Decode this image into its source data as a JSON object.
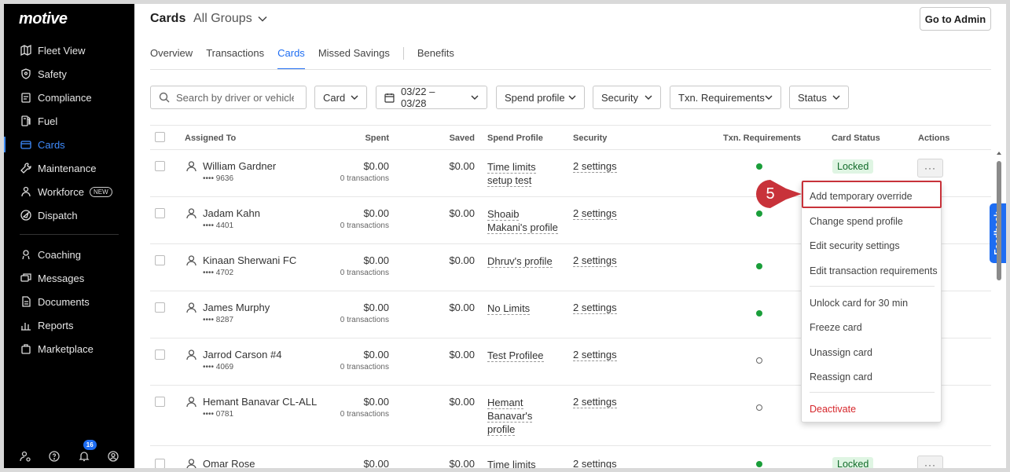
{
  "app": {
    "logo": "motive"
  },
  "sidebar": {
    "items": [
      {
        "label": "Fleet View",
        "icon": "map-icon"
      },
      {
        "label": "Safety",
        "icon": "shield-icon"
      },
      {
        "label": "Compliance",
        "icon": "clipboard-icon"
      },
      {
        "label": "Fuel",
        "icon": "fuel-pump-icon"
      },
      {
        "label": "Cards",
        "icon": "credit-card-icon",
        "active": true
      },
      {
        "label": "Maintenance",
        "icon": "wrench-icon"
      },
      {
        "label": "Workforce",
        "icon": "workforce-icon",
        "badge": "NEW"
      },
      {
        "label": "Dispatch",
        "icon": "dispatch-icon"
      },
      {
        "label": "Coaching",
        "icon": "coaching-icon"
      },
      {
        "label": "Messages",
        "icon": "messages-icon"
      },
      {
        "label": "Documents",
        "icon": "document-icon"
      },
      {
        "label": "Reports",
        "icon": "reports-icon"
      },
      {
        "label": "Marketplace",
        "icon": "shopping-bag-icon"
      }
    ],
    "notification_count": "16"
  },
  "header": {
    "title": "Cards",
    "group_selector": "All Groups",
    "admin_button": "Go to Admin"
  },
  "tabs": [
    "Overview",
    "Transactions",
    "Cards",
    "Missed Savings",
    "Benefits"
  ],
  "active_tab": "Cards",
  "filters": {
    "search_placeholder": "Search by driver or vehicle",
    "card": "Card",
    "date_range": "03/22 – 03/28",
    "spend_profile": "Spend profile",
    "security": "Security",
    "txn_requirements": "Txn. Requirements",
    "status": "Status"
  },
  "table": {
    "columns": [
      "Assigned To",
      "Spent",
      "Saved",
      "Spend Profile",
      "Security",
      "Txn. Requirements",
      "Card Status",
      "Actions"
    ],
    "rows": [
      {
        "name": "William Gardner",
        "card": "•••• 9636",
        "spent": "$0.00",
        "txns": "0 transactions",
        "saved": "$0.00",
        "profile": [
          "Time limits",
          "setup test"
        ],
        "security": "2 settings",
        "req": "on",
        "status": "Locked"
      },
      {
        "name": "Jadam Kahn",
        "card": "•••• 4401",
        "spent": "$0.00",
        "txns": "0 transactions",
        "saved": "$0.00",
        "profile": [
          "Shoaib",
          "Makani's profile"
        ],
        "security": "2 settings",
        "req": "on",
        "status": ""
      },
      {
        "name": "Kinaan Sherwani FC",
        "card": "•••• 4702",
        "spent": "$0.00",
        "txns": "0 transactions",
        "saved": "$0.00",
        "profile": [
          "Dhruv's profile"
        ],
        "security": "2 settings",
        "req": "on",
        "status": ""
      },
      {
        "name": "James Murphy",
        "card": "•••• 8287",
        "spent": "$0.00",
        "txns": "0 transactions",
        "saved": "$0.00",
        "profile": [
          "No Limits"
        ],
        "security": "2 settings",
        "req": "on",
        "status": ""
      },
      {
        "name": "Jarrod Carson #4",
        "card": "•••• 4069",
        "spent": "$0.00",
        "txns": "0 transactions",
        "saved": "$0.00",
        "profile": [
          "Test Profilee"
        ],
        "security": "2 settings",
        "req": "off",
        "status": ""
      },
      {
        "name": "Hemant Banavar CL-ALL",
        "card": "•••• 0781",
        "spent": "$0.00",
        "txns": "0 transactions",
        "saved": "$0.00",
        "profile": [
          "Hemant",
          "Banavar's",
          "profile"
        ],
        "security": "2 settings",
        "req": "off",
        "status": ""
      },
      {
        "name": "Omar Rose",
        "card": "",
        "spent": "$0.00",
        "txns": "",
        "saved": "$0.00",
        "profile": [
          "Time limits"
        ],
        "security": "2 settings",
        "req": "on",
        "status": "Locked"
      }
    ]
  },
  "actions_menu": {
    "items": [
      "Add temporary override",
      "Change spend profile",
      "Edit security settings",
      "Edit transaction requirements",
      "Unlock card for 30 min",
      "Freeze card",
      "Unassign card",
      "Reassign card",
      "Deactivate"
    ],
    "action_button": "···"
  },
  "step_badge": "5",
  "feedback_tab": "Feedback",
  "colors": {
    "accent": "#1e6df2",
    "danger": "#d6262b",
    "status_green": "#1a9e3a",
    "highlight": "#c8323a"
  }
}
